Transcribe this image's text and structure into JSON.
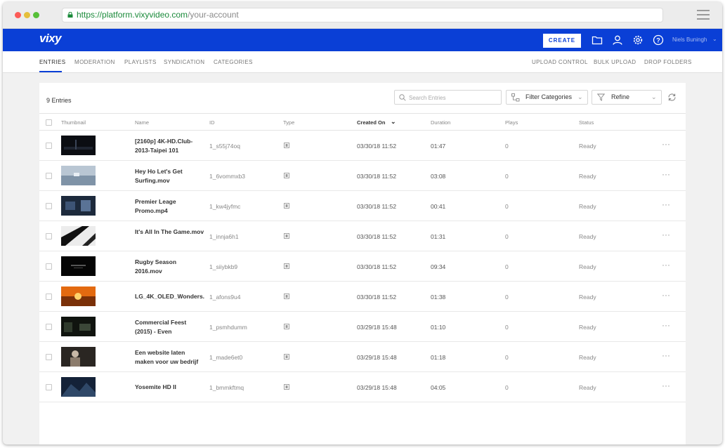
{
  "browser": {
    "url_secure": "https://platform.vixyvideo.com",
    "url_path": "/your-account"
  },
  "header": {
    "logo": "vixy",
    "create_label": "CREATE",
    "username": "Niels Buningh",
    "icons": [
      "folder-icon",
      "user-icon",
      "gear-icon",
      "help-icon"
    ]
  },
  "tabs": [
    "ENTRIES",
    "MODERATION",
    "PLAYLISTS",
    "SYNDICATION",
    "CATEGORIES"
  ],
  "actions": [
    "UPLOAD CONTROL",
    "BULK UPLOAD",
    "DROP FOLDERS"
  ],
  "toolbar": {
    "entries_count": "9 Entries",
    "search_placeholder": "Search Entries",
    "filter_label": "Filter Categories",
    "refine_label": "Refine"
  },
  "columns": [
    "Thumbnail",
    "Name",
    "ID",
    "Type",
    "Created On",
    "Duration",
    "Plays",
    "Status"
  ],
  "colors": {
    "brand_blue": "#0a3fd6"
  },
  "rows": [
    {
      "name": "[2160p] 4K-HD.Club-2013-Taipei 101",
      "id": "1_s55j74oq",
      "created": "03/30/18 11:52",
      "duration": "01:47",
      "plays": "0",
      "status": "Ready"
    },
    {
      "name": "Hey Ho Let's Get Surfing.mov",
      "id": "1_6vommxb3",
      "created": "03/30/18 11:52",
      "duration": "03:08",
      "plays": "0",
      "status": "Ready"
    },
    {
      "name": "Premier Leage Promo.mp4",
      "id": "1_kw4jyfmc",
      "created": "03/30/18 11:52",
      "duration": "00:41",
      "plays": "0",
      "status": "Ready"
    },
    {
      "name": "It's All In The Game.mov",
      "id": "1_innja6h1",
      "created": "03/30/18 11:52",
      "duration": "01:31",
      "plays": "0",
      "status": "Ready"
    },
    {
      "name": "Rugby Season 2016.mov",
      "id": "1_siiybkb9",
      "created": "03/30/18 11:52",
      "duration": "09:34",
      "plays": "0",
      "status": "Ready"
    },
    {
      "name": "LG_4K_OLED_Wonders.",
      "id": "1_afons9u4",
      "created": "03/30/18 11:52",
      "duration": "01:38",
      "plays": "0",
      "status": "Ready"
    },
    {
      "name": "Commercial Feest (2015) - Even",
      "id": "1_psmhdumm",
      "created": "03/29/18 15:48",
      "duration": "01:10",
      "plays": "0",
      "status": "Ready"
    },
    {
      "name": "Een website laten maken voor uw bedrijf",
      "id": "1_made6et0",
      "created": "03/29/18 15:48",
      "duration": "01:18",
      "plays": "0",
      "status": "Ready"
    },
    {
      "name": "Yosemite HD II",
      "id": "1_bmmkftmq",
      "created": "03/29/18 15:48",
      "duration": "04:05",
      "plays": "0",
      "status": "Ready"
    }
  ]
}
